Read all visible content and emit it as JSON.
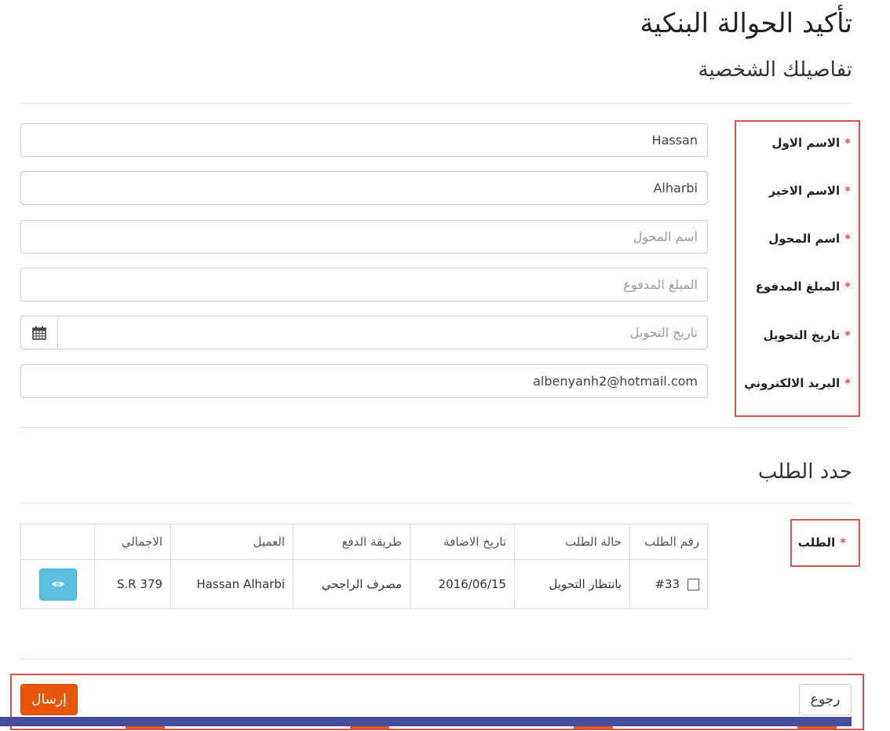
{
  "page": {
    "title": "تأكيد الحوالة البنكية"
  },
  "personal": {
    "section_title": "تفاصيلك الشخصية",
    "required_mark": "*",
    "fields": [
      {
        "label": "الاسم الاول",
        "value": "Hassan",
        "placeholder": ""
      },
      {
        "label": "الاسم الاخير",
        "value": "Alharbi",
        "placeholder": ""
      },
      {
        "label": "اسم المحول",
        "value": "",
        "placeholder": "اسم المحول"
      },
      {
        "label": "المبلغ المدفوع",
        "value": "",
        "placeholder": "المبلغ المدفوع"
      },
      {
        "label": "تاريخ التحويل",
        "value": "",
        "placeholder": "تاريخ التحويل"
      },
      {
        "label": "البريد الالكتروني",
        "value": "albenyanh2@hotmail.com",
        "placeholder": ""
      }
    ]
  },
  "order": {
    "section_title": "حدد الطلب",
    "label": "الطلب",
    "columns": [
      "رقم الطلب",
      "حالة الطلب",
      "تاريخ الاضافة",
      "طريقة الدفع",
      "العميل",
      "الاجمالي"
    ],
    "rows": [
      {
        "order_no": "#33",
        "status": "بانتظار التحويل",
        "date": "2016/06/15",
        "payment": "مصرف الراجحي",
        "customer": "Hassan Alharbi",
        "total": "S.R 379"
      }
    ]
  },
  "buttons": {
    "back": "رجوع",
    "send": "إرسال"
  },
  "colors": {
    "highlight": "#d9534f",
    "primary": "#e8560c",
    "info": "#5bc0de",
    "bar": "#454d9c"
  },
  "icons": {
    "calendar": "calendar-icon",
    "view": "eye-icon"
  }
}
